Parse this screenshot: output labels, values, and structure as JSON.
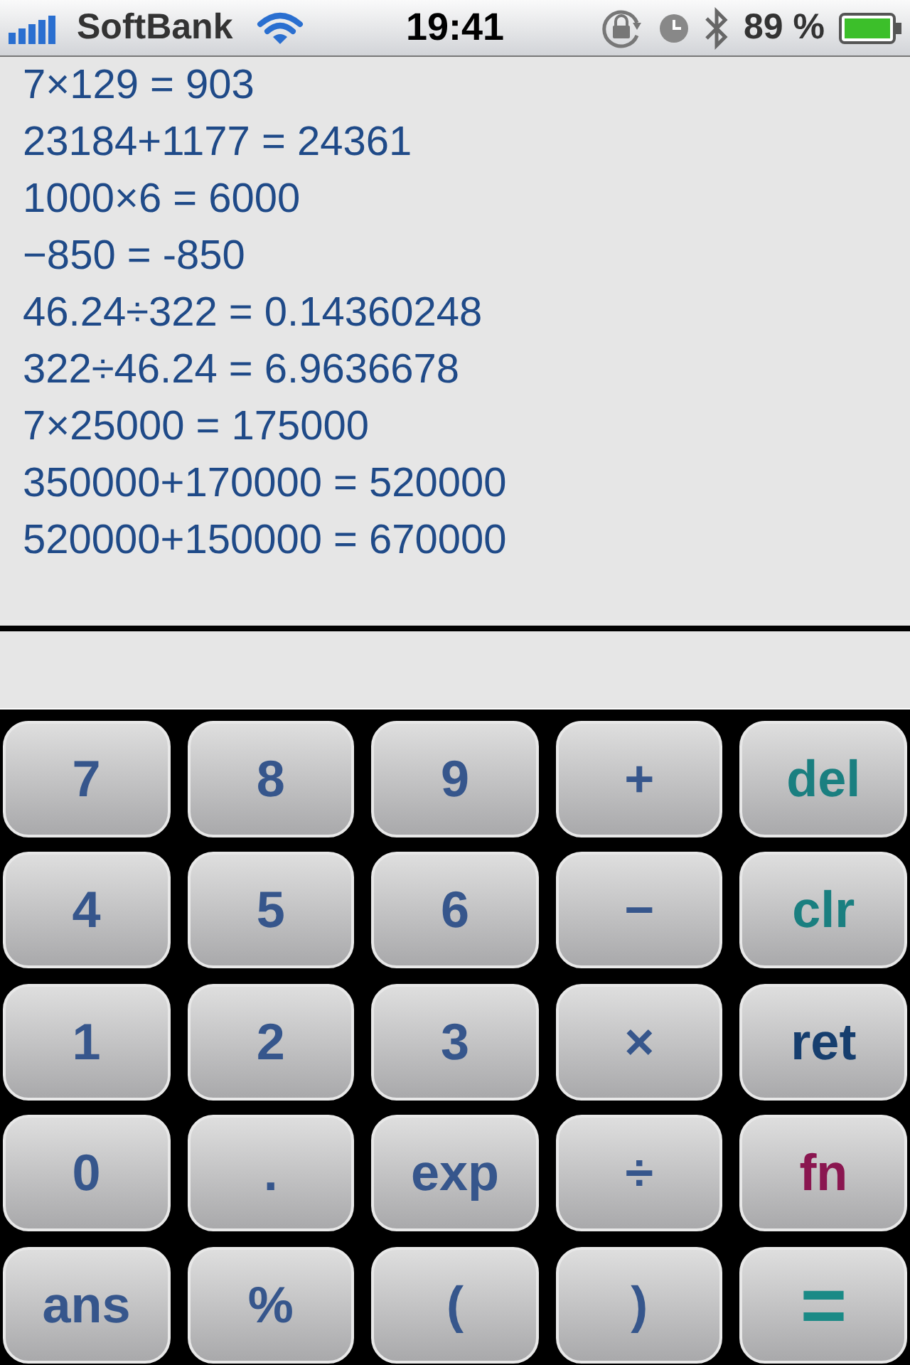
{
  "status_bar": {
    "carrier": "SoftBank",
    "time": "19:41",
    "battery": "89 %"
  },
  "history": [
    "7×129 = 903",
    "23184+1177 = 24361",
    "1000×6 = 6000",
    "−850 = -850",
    "46.24÷322 = 0.14360248",
    "322÷46.24 = 6.9636678",
    "7×25000 = 175000",
    "350000+170000 = 520000",
    "520000+150000 = 670000"
  ],
  "keys": [
    {
      "label": "7",
      "kind": "digit"
    },
    {
      "label": "8",
      "kind": "digit"
    },
    {
      "label": "9",
      "kind": "digit"
    },
    {
      "label": "+",
      "kind": "op"
    },
    {
      "label": "del",
      "kind": "edit"
    },
    {
      "label": "4",
      "kind": "digit"
    },
    {
      "label": "5",
      "kind": "digit"
    },
    {
      "label": "6",
      "kind": "digit"
    },
    {
      "label": "−",
      "kind": "op"
    },
    {
      "label": "clr",
      "kind": "edit"
    },
    {
      "label": "1",
      "kind": "digit"
    },
    {
      "label": "2",
      "kind": "digit"
    },
    {
      "label": "3",
      "kind": "digit"
    },
    {
      "label": "×",
      "kind": "op"
    },
    {
      "label": "ret",
      "kind": "ret"
    },
    {
      "label": "0",
      "kind": "digit"
    },
    {
      "label": ".",
      "kind": "digit"
    },
    {
      "label": "exp",
      "kind": "op"
    },
    {
      "label": "÷",
      "kind": "op"
    },
    {
      "label": "fn",
      "kind": "fn"
    },
    {
      "label": "ans",
      "kind": "op"
    },
    {
      "label": "%",
      "kind": "op"
    },
    {
      "label": "(",
      "kind": "op"
    },
    {
      "label": ")",
      "kind": "op"
    },
    {
      "label": "=",
      "kind": "equals"
    }
  ]
}
